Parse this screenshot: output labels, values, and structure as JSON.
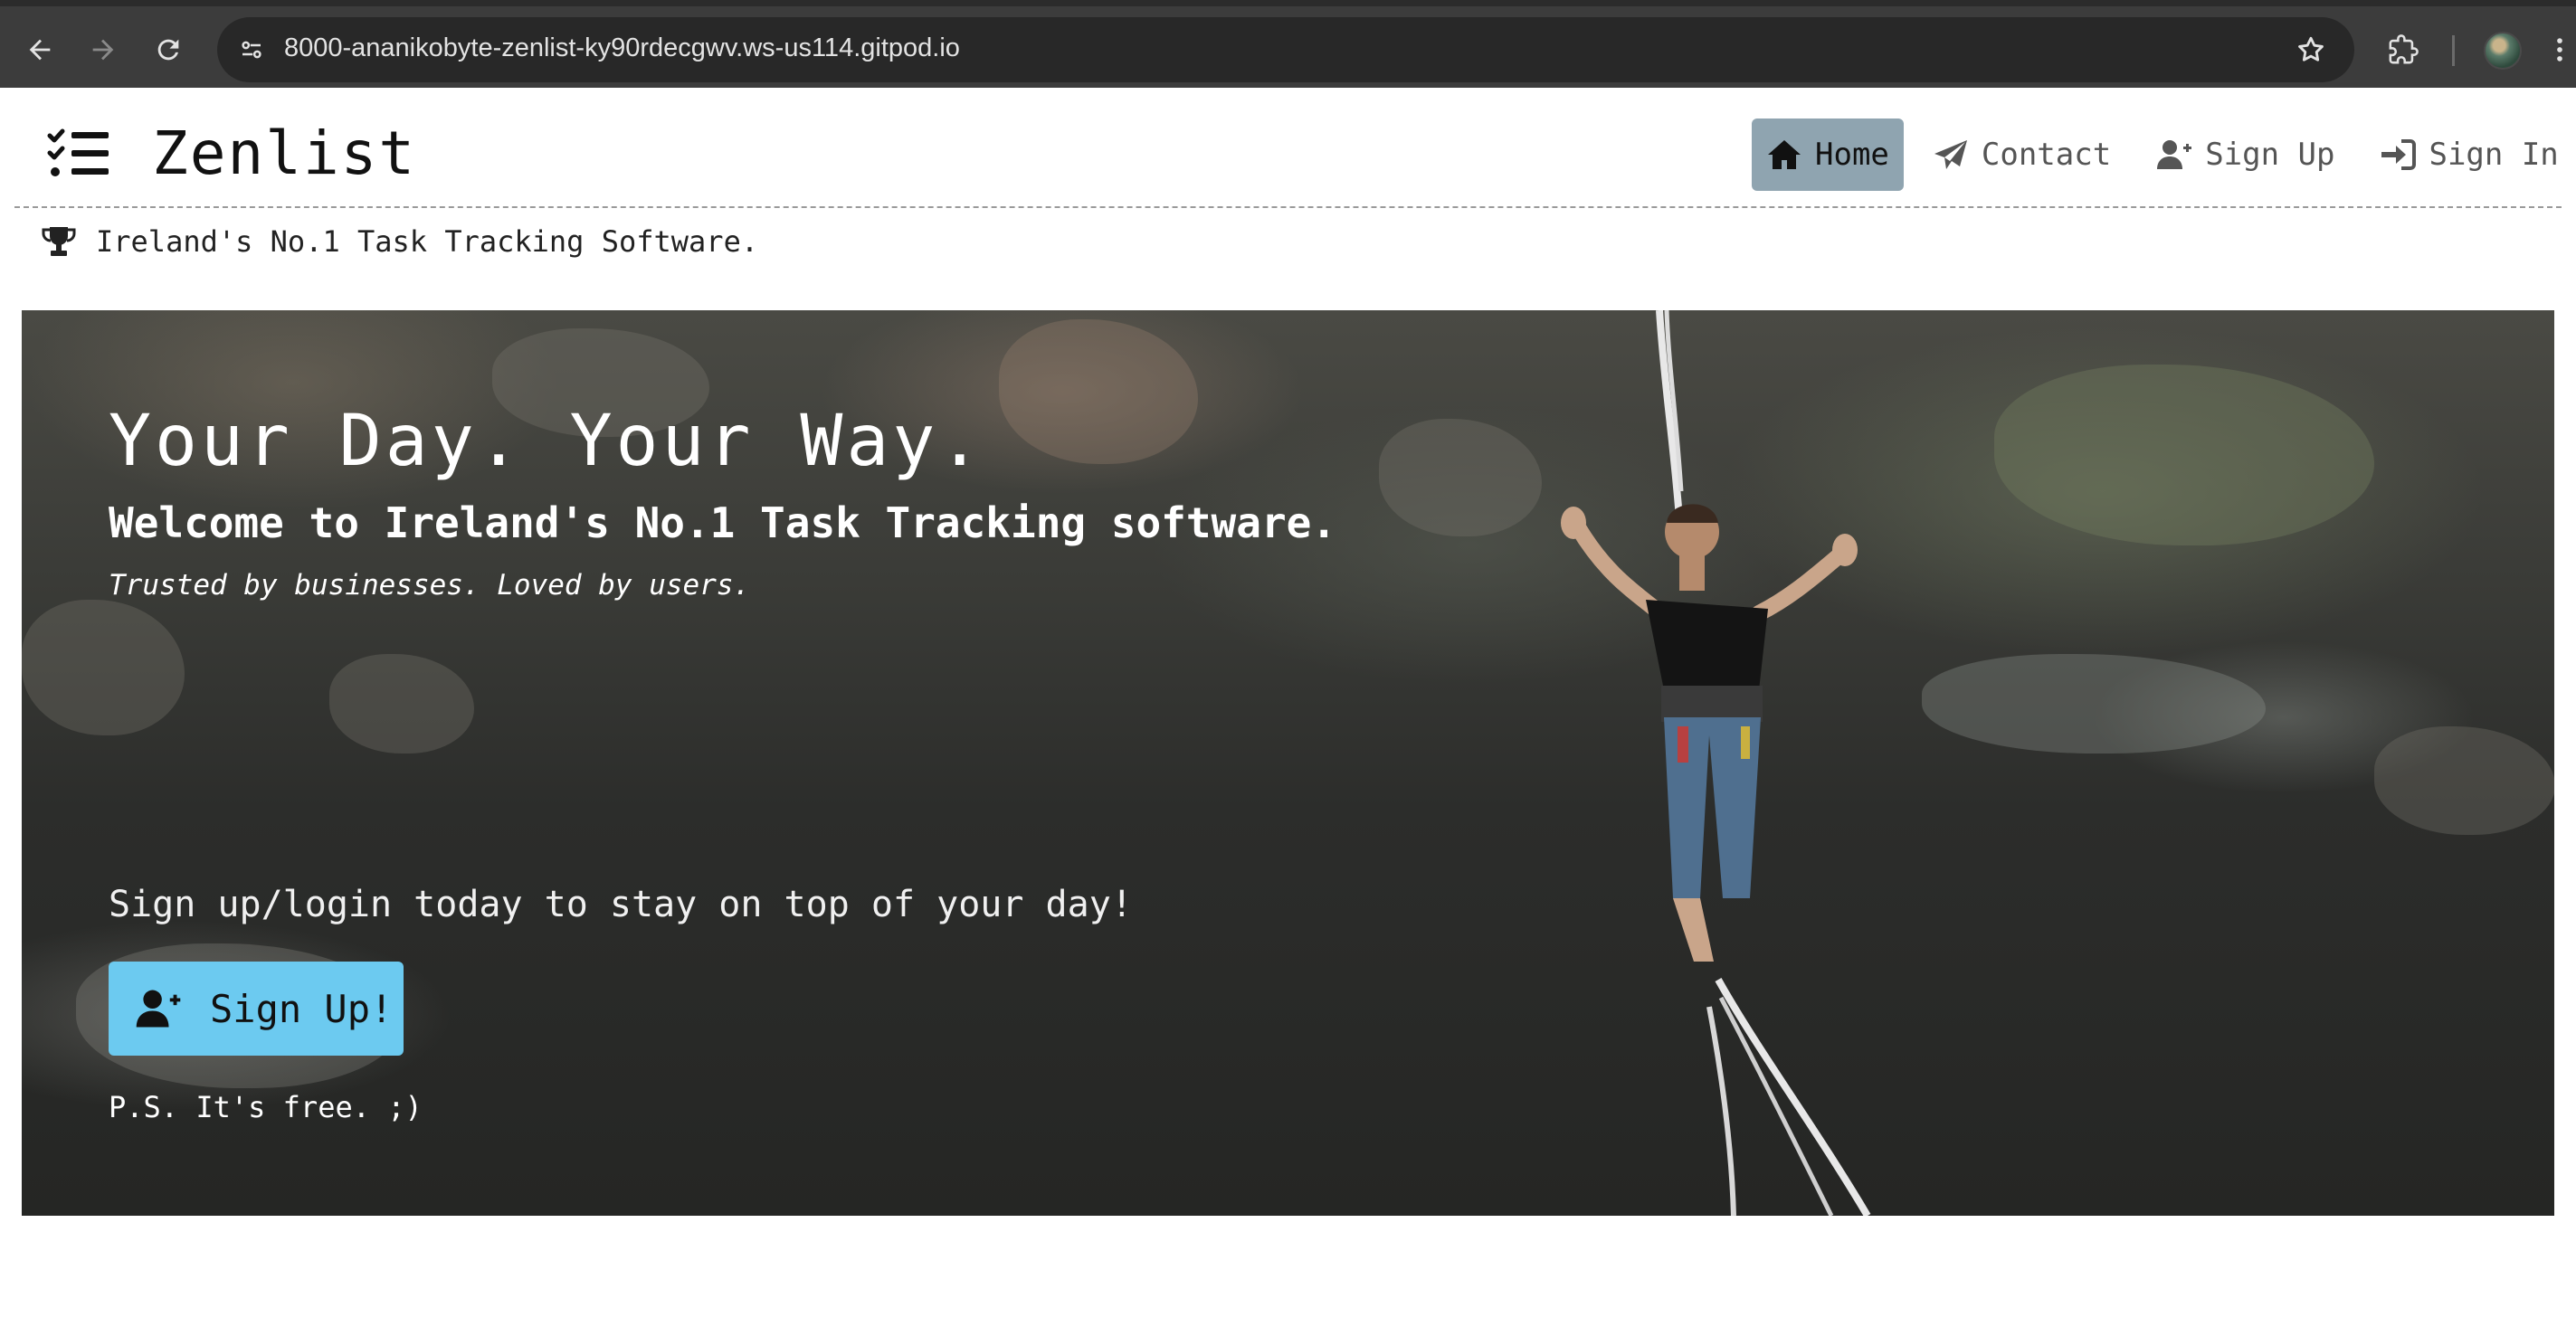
{
  "browser": {
    "url": "8000-ananikobyte-zenlist-ky90rdecgwv.ws-us114.gitpod.io",
    "icons": [
      "back-icon",
      "forward-icon",
      "reload-icon",
      "site-info-icon",
      "bookmark-star-icon",
      "extensions-icon",
      "profile-avatar",
      "menu-icon"
    ]
  },
  "navbar": {
    "brand": "Zenlist",
    "brand_icon": "list-check-icon",
    "links": [
      {
        "label": "Home",
        "icon": "home-icon",
        "active": true
      },
      {
        "label": "Contact",
        "icon": "paper-plane-icon",
        "active": false
      },
      {
        "label": "Sign Up",
        "icon": "user-plus-icon",
        "active": false
      },
      {
        "label": "Sign In",
        "icon": "sign-in-icon",
        "active": false
      }
    ]
  },
  "tagline": {
    "icon": "trophy-icon",
    "text": "Ireland's No.1 Task Tracking Software."
  },
  "hero": {
    "title": "Your Day. Your Way.",
    "subtitle": "Welcome to Ireland's No.1 Task Tracking software.",
    "trusted": "Trusted by businesses. Loved by users.",
    "cta_text": "Sign up/login today to stay on top of your day!",
    "button_label": "Sign Up!",
    "button_icon": "user-plus-icon",
    "ps": "P.S. It's free. ;)"
  },
  "colors": {
    "chrome_bg": "#3c3c3c",
    "omnibox_bg": "#282828",
    "nav_active_bg": "#8fa4b0",
    "signup_button_bg": "#6ccaf0",
    "hero_text": "#ffffff"
  }
}
